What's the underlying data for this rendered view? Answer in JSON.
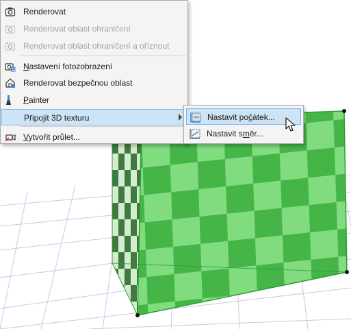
{
  "menu": {
    "items": [
      {
        "label": "Renderovat",
        "icon": "camera-icon",
        "enabled": true
      },
      {
        "label": "Renderovat oblast ohraničení",
        "icon": "camera-region-icon",
        "enabled": false
      },
      {
        "label": "Renderovat oblast ohraničení a oříznout",
        "icon": "camera-crop-icon",
        "enabled": false
      },
      {
        "label": "Nastavení fotozobrazení",
        "icon": "photo-settings-icon",
        "enabled": true
      },
      {
        "label": "Renderovat bezpečnou oblast",
        "icon": "safe-area-icon",
        "enabled": true
      },
      {
        "label": "Painter",
        "icon": "brush-icon",
        "enabled": true
      },
      {
        "label": "Připojit 3D texturu",
        "icon": "",
        "enabled": true,
        "has_submenu": true
      },
      {
        "label": "Vytvořit průlet...",
        "icon": "video-camera-icon",
        "enabled": true
      }
    ]
  },
  "submenu": {
    "items": [
      {
        "label": "Nastavit počátek...",
        "icon": "texture-origin-icon"
      },
      {
        "label": "Nastavit směr...",
        "icon": "texture-direction-icon"
      }
    ]
  },
  "colors": {
    "accent_highlight": "#cde4f7",
    "highlight_border": "#7eb4ea",
    "grid_line": "#c3cbe6",
    "checker_light": "#80dc7e",
    "checker_dark": "#45b548",
    "edge_green": "#2e9c34"
  }
}
